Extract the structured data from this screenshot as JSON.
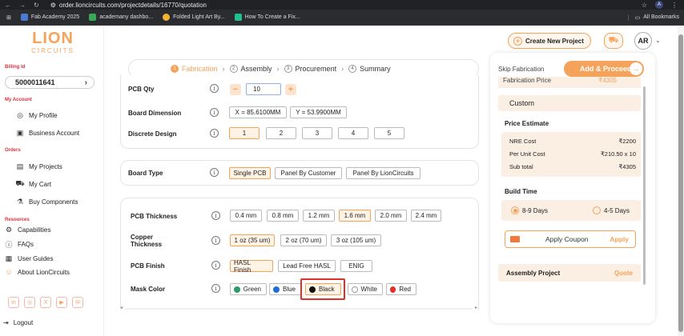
{
  "browser": {
    "url": "order.lioncircuits.com/projectdetails/16770/quotation",
    "profile": "A",
    "bookmarks": [
      {
        "label": "Fab Academy 2025",
        "color": "#4a7bd0"
      },
      {
        "label": "academany dashbo...",
        "color": "#3aa757"
      },
      {
        "label": "Folded Light Art By...",
        "color": "#f2b530"
      },
      {
        "label": "How To Create a Fix...",
        "color": "#1fbf8f"
      }
    ],
    "all_bookmarks": "All Bookmarks"
  },
  "sidebar": {
    "logo_line1": "LION",
    "logo_line2": "CIRCUITS",
    "billing_label": "Billing Id",
    "billing_id": "5000011641",
    "account_label": "My Account",
    "account_items": [
      "My Profile",
      "Business Account"
    ],
    "orders_label": "Orders",
    "orders_items": [
      "My Projects",
      "My Cart",
      "Buy Components"
    ],
    "resources_label": "Resources",
    "resources_items": [
      "Capabilities",
      "FAQs",
      "User Guides",
      "About LionCircuits"
    ],
    "logout": "Logout"
  },
  "header": {
    "create_project": "Create New Project",
    "avatar": "AR"
  },
  "stepper": {
    "steps": [
      {
        "num": "1",
        "label": "Fabrication"
      },
      {
        "num": "2",
        "label": "Assembly"
      },
      {
        "num": "3",
        "label": "Procurement"
      },
      {
        "num": "4",
        "label": "Summary"
      }
    ]
  },
  "form": {
    "pcb_qty_label": "PCB Qty",
    "pcb_qty_value": "10",
    "board_dimension_label": "Board Dimension",
    "dim_x": "X = 85.6100MM",
    "dim_y": "Y = 53.9900MM",
    "discrete_label": "Discrete Design",
    "discrete_options": [
      "1",
      "2",
      "3",
      "4",
      "5"
    ],
    "board_type_label": "Board Type",
    "board_type_options": [
      "Single PCB",
      "Panel By Customer",
      "Panel By LionCircuits"
    ],
    "thickness_label": "PCB Thickness",
    "thickness_options": [
      "0.4 mm",
      "0.8 mm",
      "1.2 mm",
      "1.6 mm",
      "2.0 mm",
      "2.4 mm"
    ],
    "copper_label_1": "Copper",
    "copper_label_2": "Thickness",
    "copper_options": [
      "1 oz (35 um)",
      "2 oz (70 um)",
      "3 oz (105 um)"
    ],
    "finish_label": "PCB Finish",
    "finish_options": [
      "HASL Finish",
      "Lead Free HASL",
      "ENIG"
    ],
    "mask_label": "Mask Color",
    "mask_options": [
      {
        "label": "Green",
        "color": "#2e9a6a"
      },
      {
        "label": "Blue",
        "color": "#1f6ed6"
      },
      {
        "label": "Black",
        "color": "#111111"
      },
      {
        "label": "White",
        "color": "#ffffff"
      },
      {
        "label": "Red",
        "color": "#e0302b"
      }
    ]
  },
  "summary": {
    "skip": "Skip Fabrication",
    "add_proceed": "Add & Proceed",
    "fab_price_label": "Fabrication Price",
    "fab_price_value": "₹4305",
    "custom": "Custom",
    "price_estimate_title": "Price Estimate",
    "nre_label": "NRE Cost",
    "nre_value": "₹2200",
    "unit_label": "Per Unit Cost",
    "unit_value": "₹210.50 x 10",
    "subtotal_label": "Sub total",
    "subtotal_value": "₹4305",
    "build_time_title": "Build Time",
    "build_opt1": "8-9 Days",
    "build_opt2": "4-5 Days",
    "coupon_label": "Apply Coupon",
    "coupon_action": "Apply",
    "assembly_label": "Assembly Project",
    "assembly_action": "Quote"
  },
  "colors": {
    "accent": "#f5a35b",
    "highlight": "#e0302b"
  }
}
